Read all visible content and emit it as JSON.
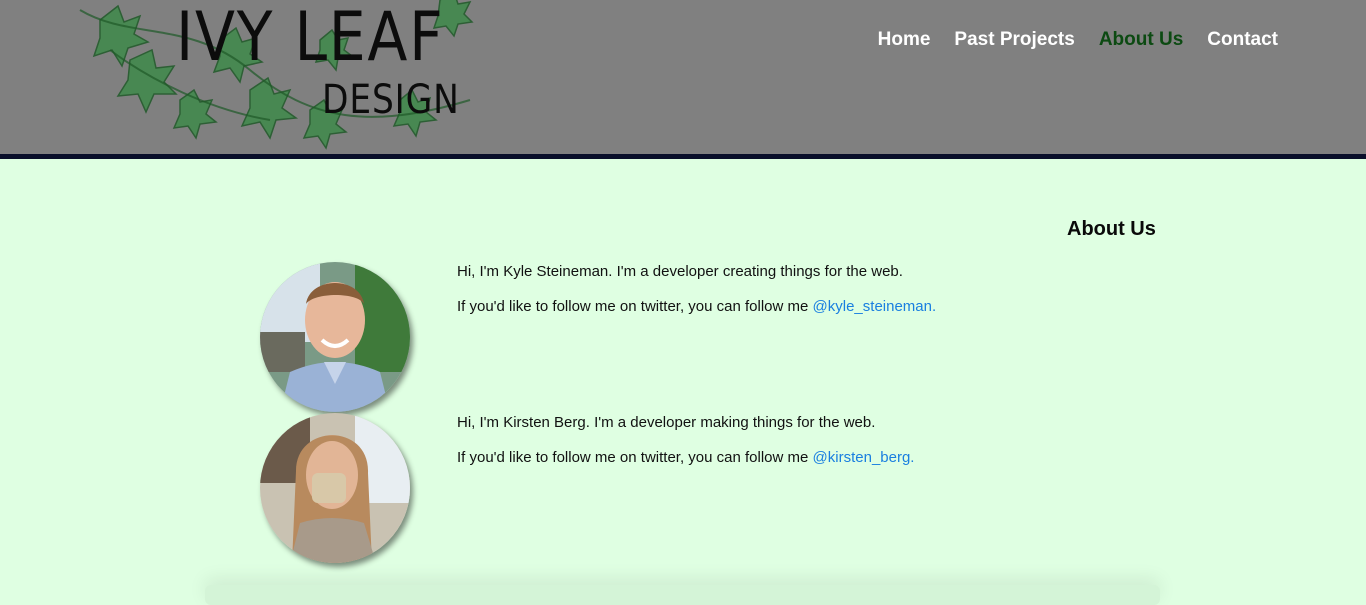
{
  "header": {
    "logo": {
      "title": "IVY LEAF",
      "subtitle": "DESIGN"
    },
    "nav": [
      {
        "label": "Home",
        "active": false
      },
      {
        "label": "Past Projects",
        "active": false
      },
      {
        "label": "About Us",
        "active": true
      },
      {
        "label": "Contact",
        "active": false
      }
    ]
  },
  "main": {
    "title": "About Us",
    "members": [
      {
        "intro": "Hi, I'm Kyle Steineman. I'm a developer creating things for the web.",
        "follow_text": "If you'd like to follow me on twitter, you can follow me ",
        "handle": "@kyle_steineman."
      },
      {
        "intro": "Hi, I'm Kirsten Berg. I'm a developer making things for the web.",
        "follow_text": "If you'd like to follow me on twitter, you can follow me ",
        "handle": "@kirsten_berg."
      }
    ]
  },
  "colors": {
    "header_bg": "#808080",
    "header_border": "#0a0f2a",
    "page_bg": "#dfffe2",
    "nav_active": "#0c4a12",
    "link": "#1a7fe0"
  }
}
